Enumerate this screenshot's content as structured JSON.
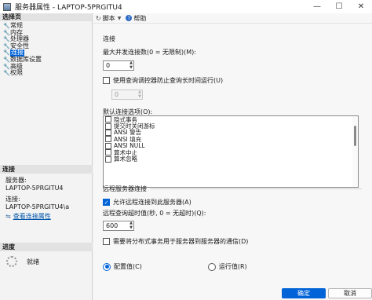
{
  "window": {
    "title": "服务器属性 - LAPTOP-5PRGITU4",
    "minimize": "—",
    "maximize": "☐",
    "close": "✕"
  },
  "sidebar": {
    "header": "选择页",
    "items": [
      {
        "label": "常规",
        "selected": false
      },
      {
        "label": "内存",
        "selected": false
      },
      {
        "label": "处理器",
        "selected": false
      },
      {
        "label": "安全性",
        "selected": false
      },
      {
        "label": "连接",
        "selected": true
      },
      {
        "label": "数据库设置",
        "selected": false
      },
      {
        "label": "高级",
        "selected": false
      },
      {
        "label": "权限",
        "selected": false
      }
    ]
  },
  "connection_panel": {
    "header": "连接",
    "server_label": "服务器:",
    "server_value": "LAPTOP-5PRGITU4",
    "conn_label": "连接:",
    "conn_value": "LAPTOP-5PRGITU4\\a",
    "view_link": "查看连接属性"
  },
  "progress_panel": {
    "header": "进度",
    "status": "就绪"
  },
  "toolbar": {
    "script": "脚本",
    "help": "帮助"
  },
  "connections": {
    "group_title": "连接",
    "max_conn_label": "最大并发连接数(0 = 无限制)(M):",
    "max_conn_value": "0",
    "governor_label": "使用查询调控器防止查询长时间运行(U)",
    "governor_value": "0",
    "default_options_label": "默认连接选项(O):",
    "options": [
      {
        "label": "隐式事务",
        "checked": false
      },
      {
        "label": "提交时关闭游标",
        "checked": false
      },
      {
        "label": "ANSI 警告",
        "checked": false
      },
      {
        "label": "ANSI 填充",
        "checked": false
      },
      {
        "label": "ANSI NULL",
        "checked": false
      },
      {
        "label": "算术中止",
        "checked": false
      },
      {
        "label": "算术忽略",
        "checked": false
      }
    ]
  },
  "remote": {
    "group_title": "远程服务器连接",
    "allow_label": "允许远程连接到此服务器(A)",
    "allow_checked": true,
    "timeout_label": "远程查询超时值(秒, 0 = 无超时)(Q):",
    "timeout_value": "600",
    "dist_label": "需要将分布式事务用于服务器到服务器的通信(D)"
  },
  "radios": {
    "config_label": "配置值(C)",
    "runtime_label": "运行值(R)",
    "selected": "config"
  },
  "buttons": {
    "ok": "确定",
    "cancel": "取消"
  }
}
